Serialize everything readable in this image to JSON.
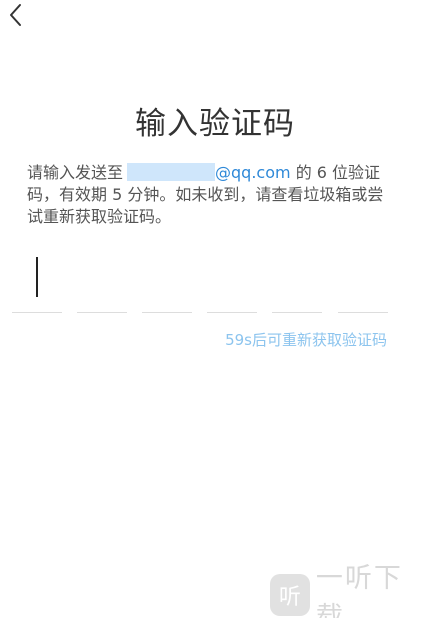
{
  "header": {
    "back_icon": "chevron-left-icon"
  },
  "title": "输入验证码",
  "description": {
    "part1": "请输入发送至",
    "email_visible": "@qq.com",
    "part2": "的 6 位验证码，有效期 5 分钟。如未收到，请查看垃圾箱或尝试重新获取验证码。"
  },
  "code_input": {
    "digits": [
      "",
      "",
      "",
      "",
      "",
      ""
    ],
    "length": 6
  },
  "resend": {
    "label": "59s后可重新获取验证码"
  },
  "watermark": {
    "logo_char": "听",
    "text": "一听下载"
  },
  "colors": {
    "accent": "#2f89d8",
    "resend_disabled": "#8cc4ee",
    "mask": "#cfe6fb"
  }
}
